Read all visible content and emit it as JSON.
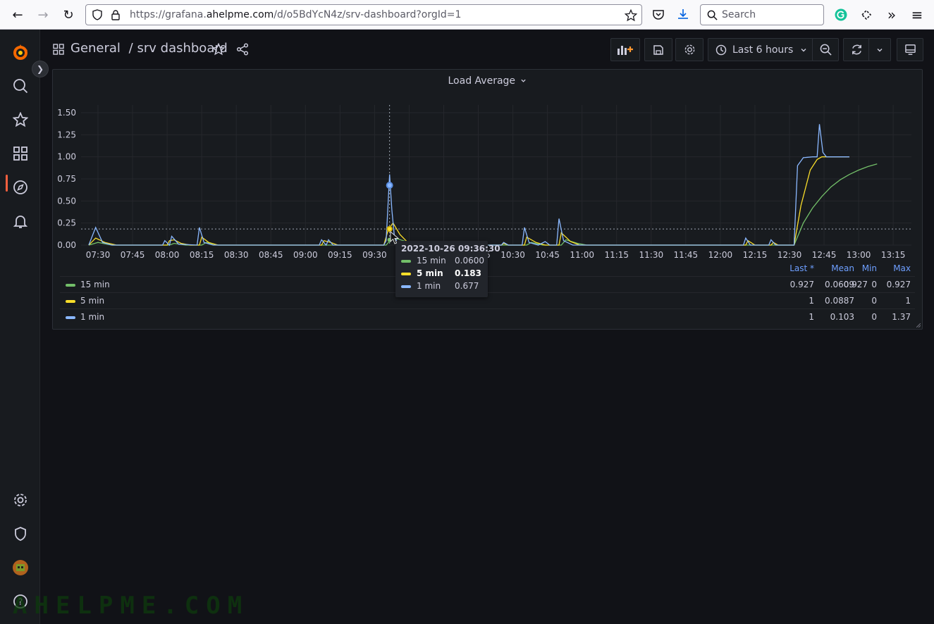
{
  "browser": {
    "url_prefix": "https://grafana.",
    "url_domain": "ahelpme.com",
    "url_path": "/d/o5BdYcN4z/srv-dashboard?orgId=1",
    "search_placeholder": "Search"
  },
  "breadcrumb": {
    "folder": "General",
    "separator": "/",
    "dashboard": "srv dashboard"
  },
  "toolbar": {
    "time_range": "Last 6 hours"
  },
  "panel": {
    "title": "Load Average",
    "legend_headers": [
      "Last *",
      "Mean",
      "Min",
      "Max"
    ],
    "legend": [
      {
        "name": "15 min",
        "color": "#73bf69",
        "last": "0.927",
        "mean": "0.0609",
        "min": "0",
        "max": "0.927"
      },
      {
        "name": "5 min",
        "color": "#fade2a",
        "last": "1",
        "mean": "0.0887",
        "min": "0",
        "max": "1"
      },
      {
        "name": "1 min",
        "color": "#8ab8ff",
        "last": "1",
        "mean": "0.103",
        "min": "0",
        "max": "1.37"
      }
    ]
  },
  "tooltip": {
    "time": "2022-10-26 09:36:30",
    "rows": [
      {
        "name": "15 min",
        "value": "0.0600",
        "color": "#73bf69"
      },
      {
        "name": "5 min",
        "value": "0.183",
        "color": "#fade2a"
      },
      {
        "name": "1 min",
        "value": "0.677",
        "color": "#8ab8ff"
      }
    ]
  },
  "chart_data": {
    "type": "line",
    "title": "Load Average",
    "ylim": [
      0,
      1.5
    ],
    "y_ticks": [
      "0.00",
      "0.25",
      "0.50",
      "0.75",
      "1.00",
      "1.25",
      "1.50"
    ],
    "x_ticks": [
      "07:30",
      "07:45",
      "08:00",
      "08:15",
      "08:30",
      "08:45",
      "09:00",
      "09:15",
      "09:30",
      "09:45",
      "10:00",
      "10:15",
      "10:30",
      "10:45",
      "11:00",
      "11:15",
      "11:30",
      "11:45",
      "12:00",
      "12:15",
      "12:30",
      "12:45",
      "13:00",
      "13:15"
    ],
    "x_unit": "minutes since 07:30",
    "grid": true,
    "series": [
      {
        "name": "1 min",
        "color": "#8ab8ff",
        "points": [
          [
            -4,
            0
          ],
          [
            -1,
            0.2
          ],
          [
            2,
            0.03
          ],
          [
            6,
            0
          ],
          [
            28,
            0
          ],
          [
            29,
            0.05
          ],
          [
            31,
            0
          ],
          [
            32,
            0.1
          ],
          [
            35,
            0.01
          ],
          [
            43,
            0
          ],
          [
            44,
            0.2
          ],
          [
            46,
            0.03
          ],
          [
            50,
            0
          ],
          [
            96,
            0
          ],
          [
            97,
            0.06
          ],
          [
            99,
            0
          ],
          [
            100,
            0.06
          ],
          [
            102,
            0
          ],
          [
            124,
            0
          ],
          [
            125,
            0.05
          ],
          [
            126.5,
            0.8
          ],
          [
            127.5,
            0.4
          ],
          [
            128.5,
            0.12
          ],
          [
            130,
            0.02
          ],
          [
            134,
            0
          ],
          [
            175,
            0
          ],
          [
            176,
            0.03
          ],
          [
            178,
            0
          ],
          [
            184,
            0
          ],
          [
            185,
            0.2
          ],
          [
            187,
            0.03
          ],
          [
            191,
            0
          ],
          [
            194,
            0.04
          ],
          [
            196,
            0
          ],
          [
            199,
            0
          ],
          [
            200,
            0.3
          ],
          [
            202,
            0.05
          ],
          [
            206,
            0
          ],
          [
            280,
            0
          ],
          [
            281,
            0.08
          ],
          [
            283,
            0
          ],
          [
            291,
            0
          ],
          [
            292,
            0.06
          ],
          [
            294,
            0
          ],
          [
            302,
            0
          ],
          [
            303.5,
            0.9
          ],
          [
            306,
            0.99
          ],
          [
            310,
            1.0
          ],
          [
            312,
            1.0
          ],
          [
            313,
            1.37
          ],
          [
            314.5,
            1.05
          ],
          [
            316,
            1.0
          ],
          [
            326,
            1.0
          ]
        ]
      },
      {
        "name": "5 min",
        "color": "#fade2a",
        "points": [
          [
            -4,
            0
          ],
          [
            -1,
            0.08
          ],
          [
            3,
            0.03
          ],
          [
            8,
            0
          ],
          [
            30,
            0
          ],
          [
            31,
            0.05
          ],
          [
            33,
            0.06
          ],
          [
            36,
            0.02
          ],
          [
            40,
            0
          ],
          [
            44,
            0
          ],
          [
            45,
            0.09
          ],
          [
            48,
            0.03
          ],
          [
            52,
            0
          ],
          [
            97,
            0
          ],
          [
            98,
            0.05
          ],
          [
            101,
            0.03
          ],
          [
            104,
            0
          ],
          [
            124,
            0
          ],
          [
            126,
            0.18
          ],
          [
            128,
            0.25
          ],
          [
            131,
            0.12
          ],
          [
            134,
            0.04
          ],
          [
            138,
            0
          ],
          [
            175,
            0
          ],
          [
            176,
            0.02
          ],
          [
            178,
            0
          ],
          [
            185,
            0
          ],
          [
            186,
            0.09
          ],
          [
            190,
            0.03
          ],
          [
            194,
            0
          ],
          [
            200,
            0
          ],
          [
            201,
            0.14
          ],
          [
            205,
            0.04
          ],
          [
            209,
            0
          ],
          [
            281,
            0
          ],
          [
            282,
            0.05
          ],
          [
            285,
            0
          ],
          [
            292,
            0
          ],
          [
            293,
            0.03
          ],
          [
            295,
            0
          ],
          [
            302,
            0
          ],
          [
            305,
            0.45
          ],
          [
            309,
            0.85
          ],
          [
            312,
            0.97
          ],
          [
            314,
            1.0
          ],
          [
            326,
            1.0
          ]
        ]
      },
      {
        "name": "15 min",
        "color": "#73bf69",
        "points": [
          [
            -4,
            0
          ],
          [
            0,
            0.03
          ],
          [
            6,
            0
          ],
          [
            31,
            0
          ],
          [
            33,
            0.02
          ],
          [
            38,
            0
          ],
          [
            45,
            0
          ],
          [
            47,
            0.03
          ],
          [
            52,
            0
          ],
          [
            125,
            0
          ],
          [
            127,
            0.06
          ],
          [
            130,
            0.07
          ],
          [
            135,
            0.03
          ],
          [
            140,
            0
          ],
          [
            186,
            0
          ],
          [
            188,
            0.03
          ],
          [
            193,
            0
          ],
          [
            201,
            0
          ],
          [
            203,
            0.06
          ],
          [
            208,
            0.02
          ],
          [
            212,
            0
          ],
          [
            302,
            0
          ],
          [
            306,
            0.25
          ],
          [
            310,
            0.42
          ],
          [
            314,
            0.55
          ],
          [
            318,
            0.66
          ],
          [
            322,
            0.74
          ],
          [
            326,
            0.8
          ],
          [
            330,
            0.85
          ],
          [
            334,
            0.89
          ],
          [
            338,
            0.92
          ]
        ]
      }
    ]
  }
}
